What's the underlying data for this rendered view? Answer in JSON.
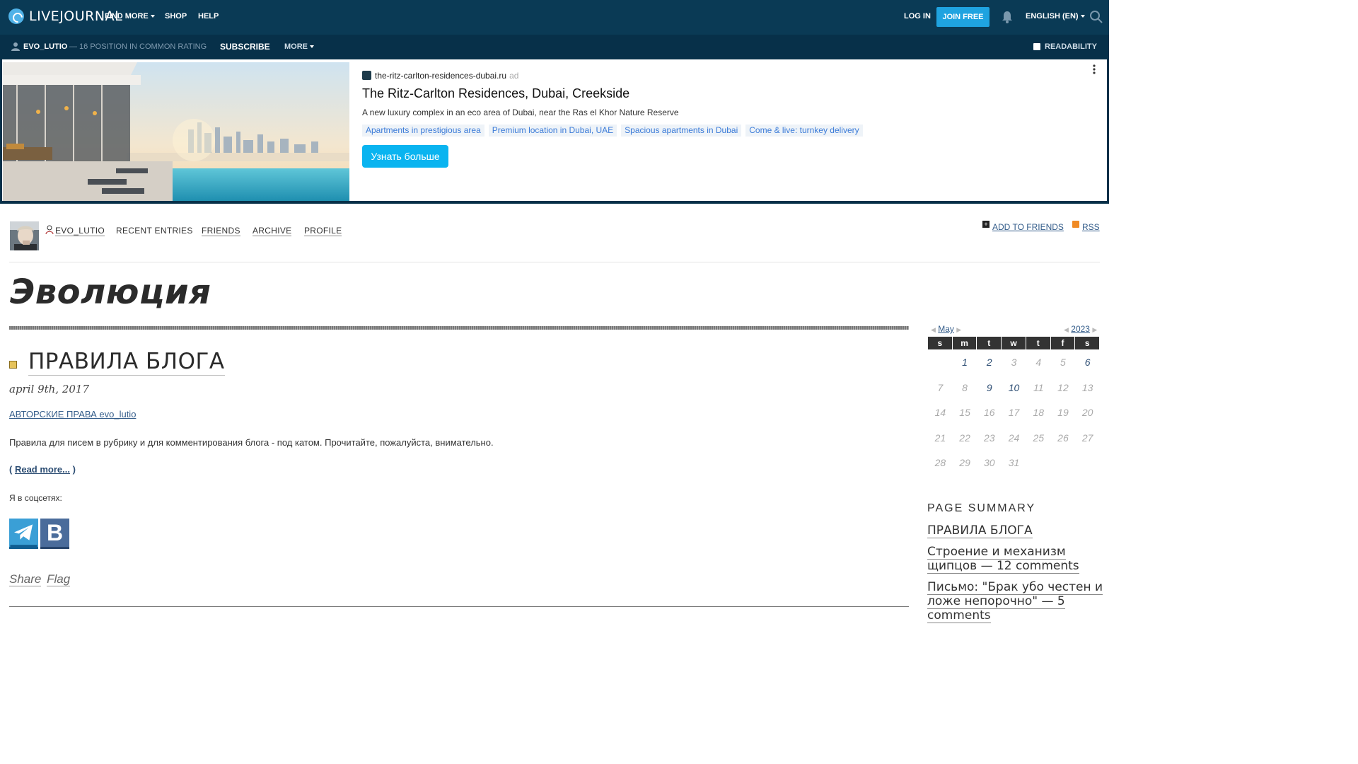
{
  "topbar": {
    "logo": "LIVEJOURNAL",
    "find_more": "FIND MORE",
    "shop": "SHOP",
    "help": "HELP",
    "login": "LOG IN",
    "join": "JOIN FREE",
    "language": "ENGLISH (EN)"
  },
  "subbar": {
    "username": "EVO_LUTIO",
    "rating": "— 16 POSITION IN COMMON RATING",
    "subscribe": "SUBSCRIBE",
    "more": "MORE",
    "readability": "READABILITY"
  },
  "ad": {
    "domain": "the-ritz-carlton-residences-dubai.ru",
    "label": "ad",
    "title": "The Ritz-Carlton Residences, Dubai, Creekside",
    "description": "A new luxury complex in an eco area of Dubai, near the Ras el Khor Nature Reserve",
    "tags": [
      "Apartments in prestigious area",
      "Premium location in Dubai, UAE",
      "Spacious apartments in Dubai",
      "Come & live: turnkey delivery"
    ],
    "cta": "Узнать больше"
  },
  "journal": {
    "username": "EVO_LUTIO",
    "nav": [
      "RECENT ENTRIES",
      "FRIENDS",
      "ARCHIVE",
      "PROFILE"
    ],
    "add_to_friends": "ADD TO FRIENDS",
    "rss": "RSS",
    "title": "Эволюция"
  },
  "entry": {
    "title": "ПРАВИЛА БЛОГА",
    "date": "april 9th, 2017",
    "tag": "АВТОРСКИЕ ПРАВА evo_lutio",
    "body": "Правила для писем в рубрику и для комментирования блога - под катом. Прочитайте, пожалуйста, внимательно.",
    "read_more": "Read more...",
    "social_label": "Я в соцсетях:",
    "share": "Share",
    "flag": "Flag"
  },
  "calendar": {
    "month": "May",
    "year": "2023",
    "weekdays": [
      "s",
      "m",
      "t",
      "w",
      "t",
      "f",
      "s"
    ],
    "weeks": [
      [
        "",
        "1",
        "2",
        "3",
        "4",
        "5",
        "6"
      ],
      [
        "7",
        "8",
        "9",
        "10",
        "11",
        "12",
        "13"
      ],
      [
        "14",
        "15",
        "16",
        "17",
        "18",
        "19",
        "20"
      ],
      [
        "21",
        "22",
        "23",
        "24",
        "25",
        "26",
        "27"
      ],
      [
        "28",
        "29",
        "30",
        "31",
        "",
        "",
        ""
      ]
    ],
    "linked_days": [
      "1",
      "2",
      "6",
      "9",
      "10"
    ]
  },
  "page_summary": {
    "title": "PAGE SUMMARY",
    "items": [
      "ПРАВИЛА БЛОГА",
      "Строение и механизм щипцов — 12 comments",
      "Письмо: \"Брак убо честен и ложе непорочно\" — 5 comments"
    ]
  }
}
